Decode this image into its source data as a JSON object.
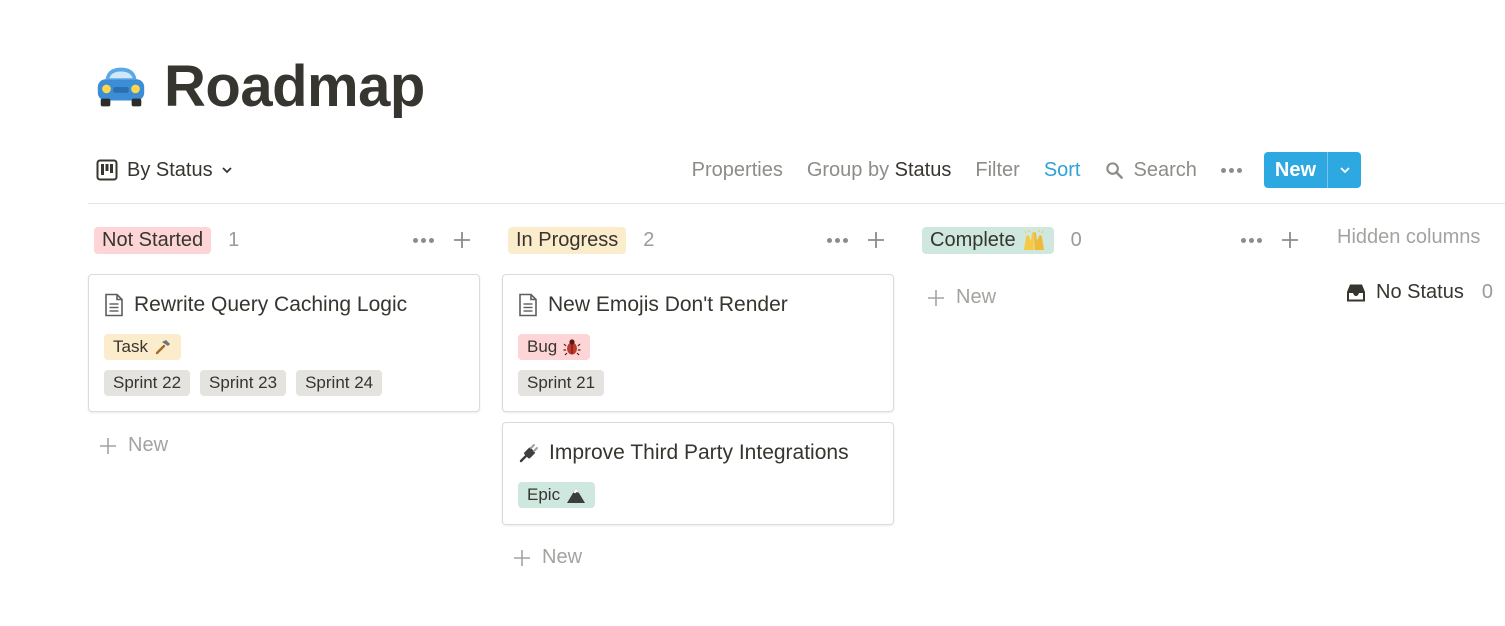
{
  "page": {
    "title": "Roadmap",
    "icon": "car-icon"
  },
  "toolbar": {
    "view_label": "By Status",
    "properties": "Properties",
    "group_by_prefix": "Group by",
    "group_by_value": "Status",
    "filter": "Filter",
    "sort": "Sort",
    "search": "Search",
    "new_label": "New"
  },
  "colors": {
    "not_started": "#fdd5d7",
    "in_progress": "#fbeccb",
    "complete": "#cfe8df",
    "accent": "#2ea8e0"
  },
  "columns": [
    {
      "status": "Not Started",
      "count": "1",
      "new_label": "New",
      "cards": [
        {
          "title": "Rewrite Query Caching Logic",
          "icon": "page-icon",
          "type": "Task",
          "type_icon": "hammer-icon",
          "sprints": [
            "Sprint 22",
            "Sprint 23",
            "Sprint 24"
          ]
        }
      ]
    },
    {
      "status": "In Progress",
      "count": "2",
      "new_label": "New",
      "cards": [
        {
          "title": "New Emojis Don't Render",
          "icon": "page-icon",
          "type": "Bug",
          "type_icon": "bug-icon",
          "sprints": [
            "Sprint 21"
          ]
        },
        {
          "title": "Improve Third Party Integrations",
          "icon": "plug-icon",
          "type": "Epic",
          "type_icon": "mountain-icon",
          "sprints": []
        }
      ]
    },
    {
      "status": "Complete",
      "status_icon": "raised-hands-icon",
      "count": "0",
      "new_label": "New",
      "cards": []
    }
  ],
  "hidden_columns": {
    "title": "Hidden columns",
    "items": [
      {
        "label": "No Status",
        "count": "0",
        "icon": "inbox-icon"
      }
    ]
  }
}
